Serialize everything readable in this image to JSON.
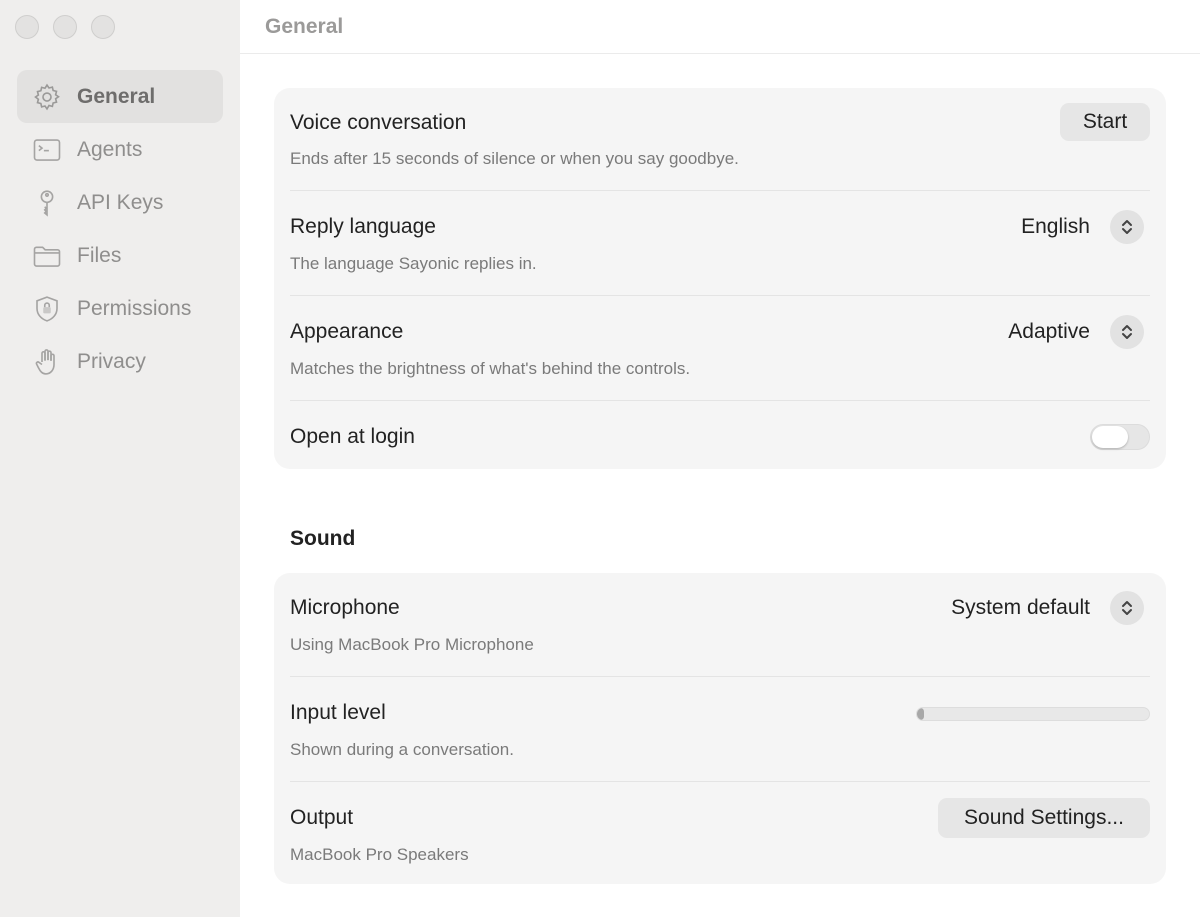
{
  "window": {
    "title": "General"
  },
  "sidebar": {
    "items": [
      {
        "label": "General",
        "icon": "gear-icon",
        "active": true
      },
      {
        "label": "Agents",
        "icon": "terminal-icon",
        "active": false
      },
      {
        "label": "API Keys",
        "icon": "key-icon",
        "active": false
      },
      {
        "label": "Files",
        "icon": "folder-icon",
        "active": false
      },
      {
        "label": "Permissions",
        "icon": "shield-lock-icon",
        "active": false
      },
      {
        "label": "Privacy",
        "icon": "hand-icon",
        "active": false
      }
    ]
  },
  "general": {
    "voice": {
      "title": "Voice conversation",
      "desc": "Ends after 15 seconds of silence or when you say goodbye.",
      "button": "Start"
    },
    "reply_language": {
      "title": "Reply language",
      "desc": "The language Sayonic replies in.",
      "value": "English"
    },
    "appearance": {
      "title": "Appearance",
      "desc": "Matches the brightness of what's behind the controls.",
      "value": "Adaptive"
    },
    "open_at_login": {
      "title": "Open at login",
      "enabled": false
    }
  },
  "sound": {
    "section_title": "Sound",
    "microphone": {
      "title": "Microphone",
      "desc": "Using MacBook Pro Microphone",
      "value": "System default"
    },
    "input_level": {
      "title": "Input level",
      "desc": "Shown during a conversation.",
      "level": 0.02
    },
    "output": {
      "title": "Output",
      "desc": "MacBook Pro Speakers",
      "button": "Sound Settings..."
    }
  },
  "colors": {
    "sidebar_bg": "#efeeed",
    "card_bg": "#f5f5f5",
    "accent_text": "#222222",
    "muted_text": "#7a7a7a"
  }
}
